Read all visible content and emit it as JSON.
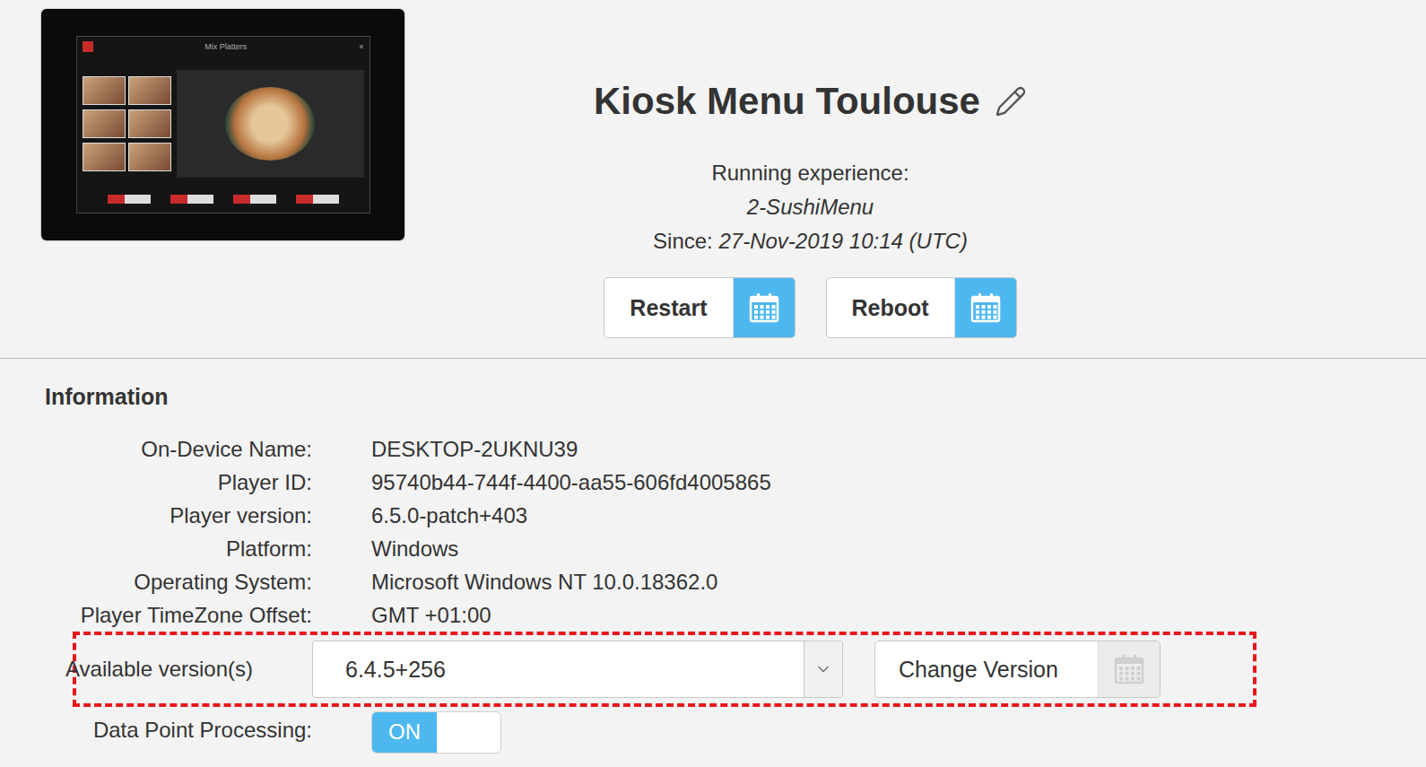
{
  "thumbnail": {
    "title": "Mix Platters",
    "close": "×"
  },
  "player": {
    "name": "Kiosk Menu Toulouse",
    "running_label": "Running experience:",
    "experience": "2-SushiMenu",
    "since_label": "Since:",
    "since": "27-Nov-2019 10:14 (UTC)"
  },
  "buttons": [
    {
      "label": "Restart",
      "schedule_enabled": true
    },
    {
      "label": "Reboot",
      "schedule_enabled": true
    }
  ],
  "info": {
    "title": "Information",
    "rows": [
      {
        "label": "On-Device Name:",
        "value": "DESKTOP-2UKNU39"
      },
      {
        "label": "Player ID:",
        "value": "95740b44-744f-4400-aa55-606fd4005865"
      },
      {
        "label": "Player version:",
        "value": "6.5.0-patch+403"
      },
      {
        "label": "Platform:",
        "value": "Windows"
      },
      {
        "label": "Operating System:",
        "value": "Microsoft Windows NT 10.0.18362.0"
      },
      {
        "label": "Player TimeZone Offset:",
        "value": "GMT +01:00"
      }
    ]
  },
  "version": {
    "label": "Available version(s)",
    "selected": "6.4.5+256",
    "button": "Change Version",
    "schedule_enabled": false
  },
  "data_point": {
    "label": "Data Point Processing:",
    "toggle": "ON",
    "on": true
  }
}
